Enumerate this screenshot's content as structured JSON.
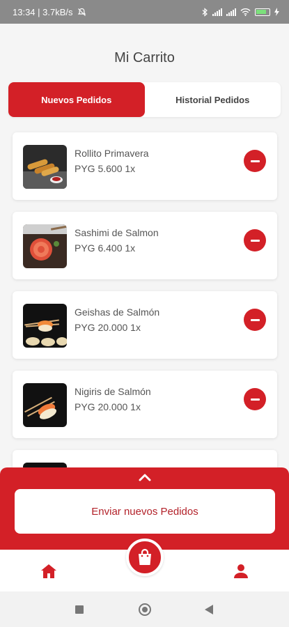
{
  "status_bar": {
    "left_text": "13:34 | 3.7kB/s",
    "icons": [
      "mute-icon",
      "bluetooth-icon",
      "signal-icon",
      "signal-icon",
      "wifi-icon",
      "battery-icon",
      "charging-icon"
    ]
  },
  "page": {
    "title": "Mi Carrito"
  },
  "tabs": [
    {
      "label": "Nuevos Pedidos",
      "active": true
    },
    {
      "label": "Historial Pedidos",
      "active": false
    }
  ],
  "items": [
    {
      "name": "Rollito Primavera",
      "price": "PYG 5.600 1x"
    },
    {
      "name": "Sashimi de Salmon",
      "price": "PYG 6.400 1x"
    },
    {
      "name": "Geishas de Salmón",
      "price": "PYG 20.000 1x"
    },
    {
      "name": "Nigiris de Salmón",
      "price": "PYG 20.000 1x"
    }
  ],
  "bottom_panel": {
    "send_label": "Enviar nuevos Pedidos"
  },
  "nav": {
    "icons": [
      "home-icon",
      "shopping-bag-icon",
      "user-icon"
    ]
  },
  "colors": {
    "accent": "#d32027",
    "background": "#f5f5f5",
    "status_bar": "#8a8a8a"
  }
}
